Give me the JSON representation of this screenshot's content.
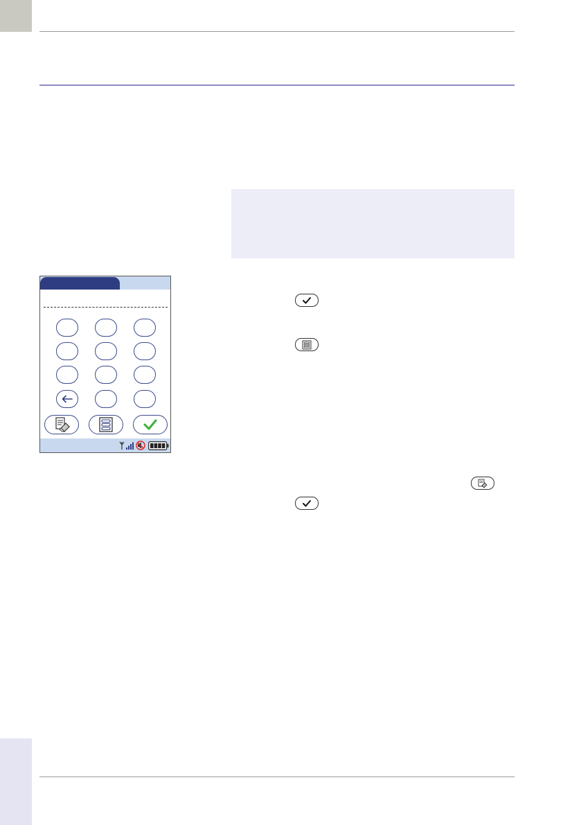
{
  "page": {
    "number": "",
    "colors": {
      "corner_tab": "#c9c8c1",
      "side_bar": "#e4e4f2",
      "heading_rule": "#8b8bc4",
      "note_box": "#ededf8",
      "screen_accent": "#2e3d82",
      "screen_header": "#c8d8ee",
      "confirm_check": "#3cae3c"
    }
  },
  "device_screen": {
    "tab_active_label": "",
    "tab_inactive_label": "",
    "entry_value": "",
    "keypad_rows": 4,
    "keypad_cols": 3,
    "keys": [
      "",
      "",
      "",
      "",
      "",
      "",
      "",
      "",
      "",
      "backspace-icon",
      "",
      ""
    ],
    "buttons": [
      "notepad-eraser-icon",
      "list-menu-icon",
      "checkmark-icon"
    ],
    "status_icons": [
      "antenna-signal-icon",
      "no-sound-icon",
      "battery-full-icon"
    ]
  },
  "text_column": {
    "inline_icons": [
      "checkmark-icon",
      "list-menu-icon",
      "notepad-eraser-icon",
      "checkmark-icon"
    ]
  }
}
